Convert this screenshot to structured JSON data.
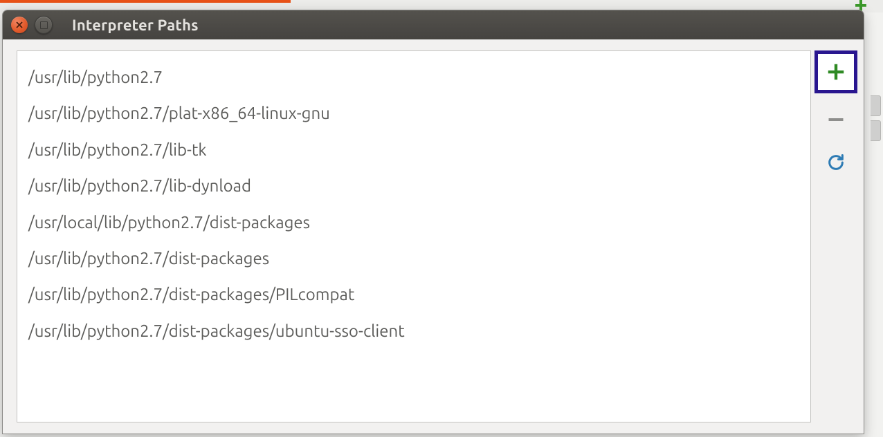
{
  "window": {
    "title": "Interpreter Paths"
  },
  "paths": [
    "/usr/lib/python2.7",
    "/usr/lib/python2.7/plat-x86_64-linux-gnu",
    "/usr/lib/python2.7/lib-tk",
    "/usr/lib/python2.7/lib-dynload",
    "/usr/local/lib/python2.7/dist-packages",
    "/usr/lib/python2.7/dist-packages",
    "/usr/lib/python2.7/dist-packages/PILcompat",
    "/usr/lib/python2.7/dist-packages/ubuntu-sso-client"
  ],
  "toolbar": {
    "add": "Add",
    "remove": "Remove",
    "reload": "Reload"
  }
}
